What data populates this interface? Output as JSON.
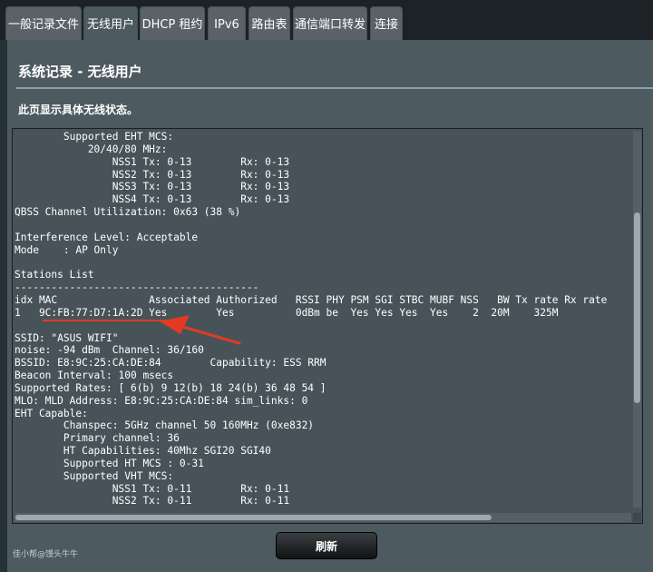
{
  "tabs": [
    {
      "label": "一般记录文件"
    },
    {
      "label": "无线用户"
    },
    {
      "label": "DHCP 租约"
    },
    {
      "label": "IPv6"
    },
    {
      "label": "路由表"
    },
    {
      "label": "通信端口转发"
    },
    {
      "label": "连接"
    }
  ],
  "page": {
    "title": "系统记录 - 无线用户",
    "description": "此页显示具体无线状态。"
  },
  "log_text": "        Supported EHT MCS:\n            20/40/80 MHz:\n                NSS1 Tx: 0-13        Rx: 0-13\n                NSS2 Tx: 0-13        Rx: 0-13\n                NSS3 Tx: 0-13        Rx: 0-13\n                NSS4 Tx: 0-13        Rx: 0-13\nQBSS Channel Utilization: 0x63 (38 %)\n\nInterference Level: Acceptable\nMode    : AP Only\n\nStations List\n----------------------------------------\nidx MAC               Associated Authorized   RSSI PHY PSM SGI STBC MUBF NSS   BW Tx rate Rx rate\n1   9C:FB:77:D7:1A:2D Yes        Yes          0dBm be  Yes Yes Yes  Yes    2  20M    325M\n\nSSID: \"ASUS WIFI\"\nnoise: -94 dBm  Channel: 36/160\nBSSID: E8:9C:25:CA:DE:84        Capability: ESS RRM\nBeacon Interval: 100 msecs\nSupported Rates: [ 6(b) 9 12(b) 18 24(b) 36 48 54 ]\nMLO: MLD Address: E8:9C:25:CA:DE:84 sim_links: 0\nEHT Capable:\n        Chanspec: 5GHz channel 50 160MHz (0xe832)\n        Primary channel: 36\n        HT Capabilities: 40Mhz SGI20 SGI40\n        Supported HT MCS : 0-31\n        Supported VHT MCS:\n                NSS1 Tx: 0-11        Rx: 0-11\n                NSS2 Tx: 0-11        Rx: 0-11",
  "refresh_label": "刷新",
  "watermark": "佳小帮@馒头牛牛",
  "colors": {
    "annotation_red": "#e43a22",
    "panel_bg": "#4d5a60",
    "log_bg": "#475359"
  }
}
